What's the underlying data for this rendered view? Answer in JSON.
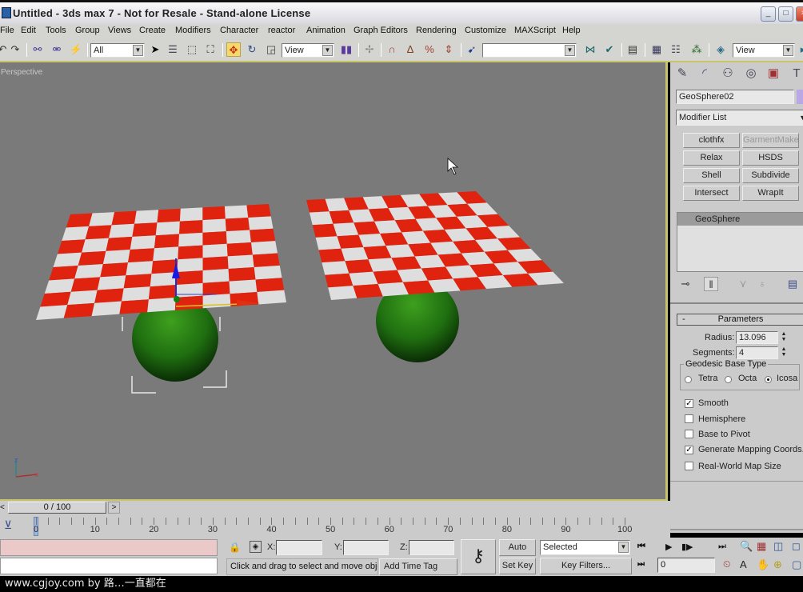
{
  "window": {
    "title": "Untitled - 3ds max 7  - Not for Resale - Stand-alone License",
    "controls": {
      "minimize": "_",
      "maximize": "□",
      "close": "×"
    }
  },
  "menu": [
    "File",
    "Edit",
    "Tools",
    "Group",
    "Views",
    "Create",
    "Modifiers",
    "Character",
    "reactor",
    "Animation",
    "Graph Editors",
    "Rendering",
    "Customize",
    "MAXScript",
    "Help"
  ],
  "toolbar": {
    "selection_filter": "All",
    "ref_coord_system": "View",
    "named_selection_set": "",
    "render_view": "View",
    "icons": [
      "undo-icon",
      "redo-icon",
      "select-and-link-icon",
      "unlink-icon",
      "bind-space-warp-icon",
      "select-object-icon",
      "select-by-name-icon",
      "rectangular-selection-icon",
      "window-crossing-icon",
      "select-and-move-icon",
      "select-and-rotate-icon",
      "select-and-scale-icon",
      "pivot-center-icon",
      "manipulate-icon",
      "snap-toggle-icon",
      "angle-snap-icon",
      "percent-snap-icon",
      "spinner-snap-icon",
      "edit-named-selection-icon",
      "mirror-icon",
      "align-icon",
      "layer-manager-icon",
      "curve-editor-icon",
      "schematic-view-icon",
      "material-editor-icon",
      "render-scene-icon",
      "quick-render-icon"
    ]
  },
  "viewport": {
    "label": "Perspective",
    "objects": [
      "checker-plane-left",
      "geosphere-left-selected",
      "checker-plane-right",
      "geosphere-right"
    ],
    "colors": {
      "background": "#7a7a7a",
      "checker_red": "#e0230f",
      "checker_white": "#dedede",
      "sphere": "#1f7a12"
    }
  },
  "command_panel": {
    "tabs": [
      "create-tab",
      "modify-tab",
      "hierarchy-tab",
      "motion-tab",
      "display-tab",
      "utilities-tab"
    ],
    "object_name": "GeoSphere02",
    "object_color": "#b9a8e6",
    "modifier_list": "Modifier List",
    "modifier_buttons": [
      {
        "label": "clothfx",
        "enabled": true
      },
      {
        "label": "GarmentMaker",
        "enabled": false
      },
      {
        "label": "Relax",
        "enabled": true
      },
      {
        "label": "HSDS",
        "enabled": true
      },
      {
        "label": "Shell",
        "enabled": true
      },
      {
        "label": "Subdivide",
        "enabled": true
      },
      {
        "label": "Intersect",
        "enabled": true
      },
      {
        "label": "WrapIt",
        "enabled": true
      }
    ],
    "modifier_stack": [
      "GeoSphere"
    ],
    "parameters": {
      "title": "Parameters",
      "collapse": "-",
      "radius_label": "Radius:",
      "radius": "13.096",
      "segments_label": "Segments:",
      "segments": "4",
      "base_type_label": "Geodesic Base Type",
      "base_types": [
        {
          "label": "Tetra",
          "selected": false
        },
        {
          "label": "Octa",
          "selected": false
        },
        {
          "label": "Icosa",
          "selected": true
        }
      ],
      "checkboxes": [
        {
          "label": "Smooth",
          "checked": true
        },
        {
          "label": "Hemisphere",
          "checked": false
        },
        {
          "label": "Base to Pivot",
          "checked": false
        },
        {
          "label": "Generate Mapping Coords.",
          "checked": true
        },
        {
          "label": "Real-World Map Size",
          "checked": false
        }
      ]
    }
  },
  "timeline": {
    "frame_display": "0 / 100",
    "current_frame": 0,
    "total_frames": 100,
    "prev": "<",
    "next": ">",
    "tick_labels": [
      "0",
      "10",
      "20",
      "30",
      "40",
      "50",
      "60",
      "70",
      "80",
      "90",
      "100"
    ]
  },
  "status_bar": {
    "x_label": "X:",
    "y_label": "Y:",
    "z_label": "Z:",
    "x_value": "",
    "y_value": "",
    "z_value": "",
    "prompt": "Click and drag to select and move obje",
    "add_time_tag": "Add Time Tag",
    "auto_key": "Auto Key",
    "set_key": "Set Key",
    "key_mode": "Selected",
    "key_filters": "Key Filters...",
    "frame_field": "0"
  },
  "watermark": "www.cgjoy.com by 路…一直都在"
}
